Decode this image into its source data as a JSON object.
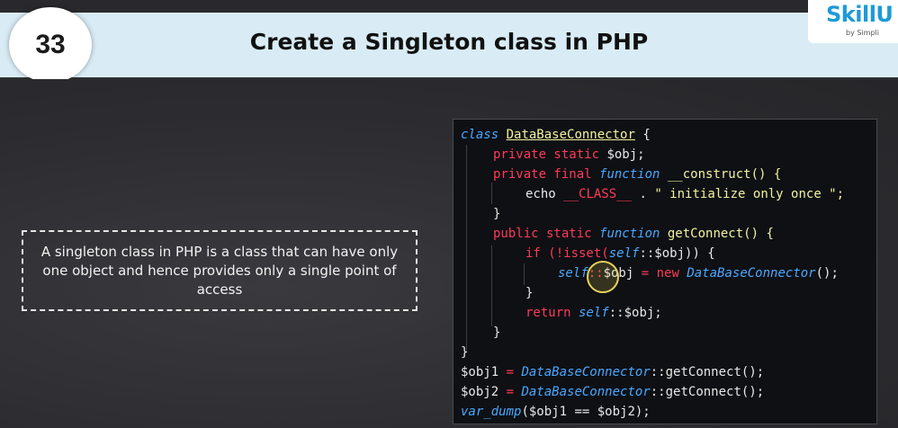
{
  "header": {
    "number": "33",
    "title": "Create a Singleton class in PHP"
  },
  "logo": {
    "main": "SkillU",
    "sub": "by Simpli"
  },
  "description": "A singleton class in PHP is a class that can have only one object and hence provides only a single point of access",
  "code": {
    "l1_kw": "class",
    "l1_name": "DataBaseConnector",
    "l1_rest": " {",
    "l2_mod": "private static",
    "l2_var": " $obj;",
    "l3_mod": "private final",
    "l3_fn": "function",
    "l3_name": " __construct() {",
    "l4_echo": "echo ",
    "l4_const": "__CLASS__",
    "l4_dot": " . ",
    "l4_str": "\" initialize only once \";",
    "l5": "}",
    "l6_mod": "public static",
    "l6_fn": "function",
    "l6_name": " getConnect() {",
    "l7_if": "if (",
    "l7_not": "!isset(",
    "l7_self": "self",
    "l7_rest": "::$obj)) {",
    "l8_self": "self",
    "l8_dc": "::",
    "l8_var": "$obj",
    "l8_eq": " = ",
    "l8_new": "new",
    "l8_cls": " DataBaseConnector",
    "l8_end": "();",
    "l9": "}",
    "l10_ret": "return",
    "l10_self": " self",
    "l10_rest": "::$obj;",
    "l11": "}",
    "l12": "}",
    "l13_var": "$obj1",
    "l13_eq": " = ",
    "l13_cls": "DataBaseConnector",
    "l13_rest": "::getConnect();",
    "l14_var": "$obj2",
    "l14_eq": " = ",
    "l14_cls": "DataBaseConnector",
    "l14_rest": "::getConnect();",
    "l15_fn": "var_dump",
    "l15_rest": "($obj1 == $obj2);"
  }
}
